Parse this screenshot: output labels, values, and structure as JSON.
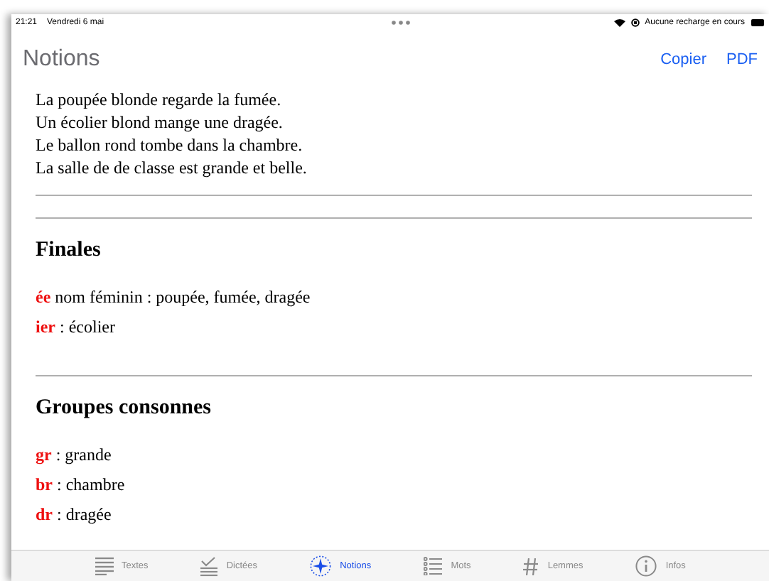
{
  "status_bar": {
    "time": "21:21",
    "date": "Vendredi 6 mai",
    "battery_text": "Aucune recharge en cours"
  },
  "nav": {
    "title": "Notions",
    "actions": [
      "Copier",
      "PDF"
    ]
  },
  "intro_lines": [
    "La poupée blonde regarde la fumée.",
    "Un écolier blond mange une dragée.",
    "Le ballon rond tombe dans la chambre.",
    "La salle de de classe est grande et belle."
  ],
  "sections": [
    {
      "heading": "Finales",
      "items": [
        "**ée** nom féminin : poupée, fumée, dragée",
        "**ier** : écolier"
      ]
    },
    {
      "heading": "Groupes consonnes",
      "items": [
        "**gr** : grande",
        "**br** : chambre",
        "**dr** : dragée"
      ]
    }
  ],
  "tabs": [
    {
      "label": "Textes",
      "kind": "lines",
      "selected": false
    },
    {
      "label": "Dictées",
      "kind": "check",
      "selected": false
    },
    {
      "label": "Notions",
      "kind": "star",
      "selected": true
    },
    {
      "label": "Mots",
      "kind": "list",
      "selected": false
    },
    {
      "label": "Lemmes",
      "kind": "hash",
      "selected": false
    },
    {
      "label": "Infos",
      "kind": "info",
      "selected": false
    }
  ]
}
